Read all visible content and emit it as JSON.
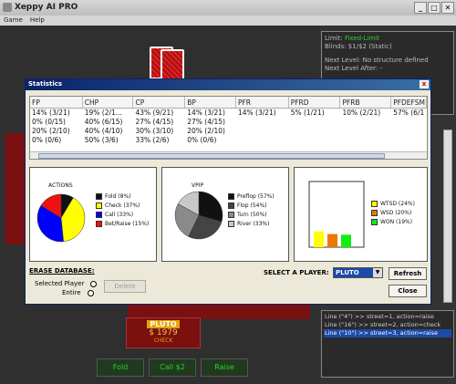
{
  "window": {
    "title": "Xeppy AI PRO",
    "min": "_",
    "max": "□",
    "close": "✕"
  },
  "menu": [
    "Game",
    "Help"
  ],
  "info": {
    "limit_label": "Limit:",
    "limit_value": "Fixed-Limit",
    "blinds": "Blinds: $1/$2 (Static)",
    "next_level": "Next Level: No structure defined",
    "next_level_after": "Next Level After: -"
  },
  "log": [
    "Line (\"4\") >> street=1, action=raise",
    "Line (\"16\") >> street=2, action=check",
    "Line (\"10\") >> street=3, action=raise"
  ],
  "player": {
    "name": "PLUTO",
    "stack": "$ 1979",
    "status": "CHECK"
  },
  "actions": {
    "fold": "Fold",
    "call": "Call $2",
    "raise": "Raise"
  },
  "dialog": {
    "title": "Statistics",
    "close": "x",
    "columns": [
      "FP",
      "CHP",
      "CP",
      "BP",
      "PFR",
      "PFRD",
      "PFRB",
      "PFDEFSM"
    ],
    "rows": [
      [
        "14% (3/21)",
        "19% (2/1...",
        "43% (9/21)",
        "14% (3/21)",
        "14% (3/21)",
        "5% (1/21)",
        "10% (2/21)",
        "57% (6/1"
      ],
      [
        "0% (0/15)",
        "40% (6/15)",
        "27% (4/15)",
        "27% (4/15)",
        "",
        "",
        "",
        ""
      ],
      [
        "20% (2/10)",
        "40% (4/10)",
        "30% (3/10)",
        "20% (2/10)",
        "",
        "",
        "",
        ""
      ],
      [
        "0% (0/6)",
        "50% (3/6)",
        "33% (2/6)",
        "0% (0/6)",
        "",
        "",
        "",
        ""
      ]
    ],
    "erase_label": "ERASE DATABASE:",
    "selected_player": "Selected Player",
    "entire": "Entire",
    "delete": "Delete",
    "select_label": "SELECT A PLAYER:",
    "selected": "PLUTO",
    "refresh": "Refresh",
    "close_btn": "Close"
  },
  "chart_data": [
    {
      "type": "pie",
      "title": "ACTIONS",
      "slices": [
        {
          "label": "Fold (8%)",
          "value": 8,
          "color": "#111111"
        },
        {
          "label": "Check (37%)",
          "value": 37,
          "color": "#ffff00"
        },
        {
          "label": "Call (33%)",
          "value": 33,
          "color": "#0000ff"
        },
        {
          "label": "Bet/Raise (15%)",
          "value": 15,
          "color": "#ee1111"
        }
      ]
    },
    {
      "type": "pie",
      "title": "VPIP",
      "slices": [
        {
          "label": "Preflop (57%)",
          "value": 57,
          "color": "#111111"
        },
        {
          "label": "Flop (54%)",
          "value": 54,
          "color": "#444444"
        },
        {
          "label": "Turn (50%)",
          "value": 50,
          "color": "#8a8a8a"
        },
        {
          "label": "River (33%)",
          "value": 33,
          "color": "#c8c8c8"
        }
      ]
    },
    {
      "type": "bar",
      "categories": [
        "WTSD (24%)",
        "WSD (20%)",
        "WON (19%)"
      ],
      "values": [
        24,
        20,
        19
      ],
      "colors": [
        "#ffff00",
        "#ee7700",
        "#11ee11"
      ],
      "ylim": [
        0,
        100
      ]
    }
  ]
}
